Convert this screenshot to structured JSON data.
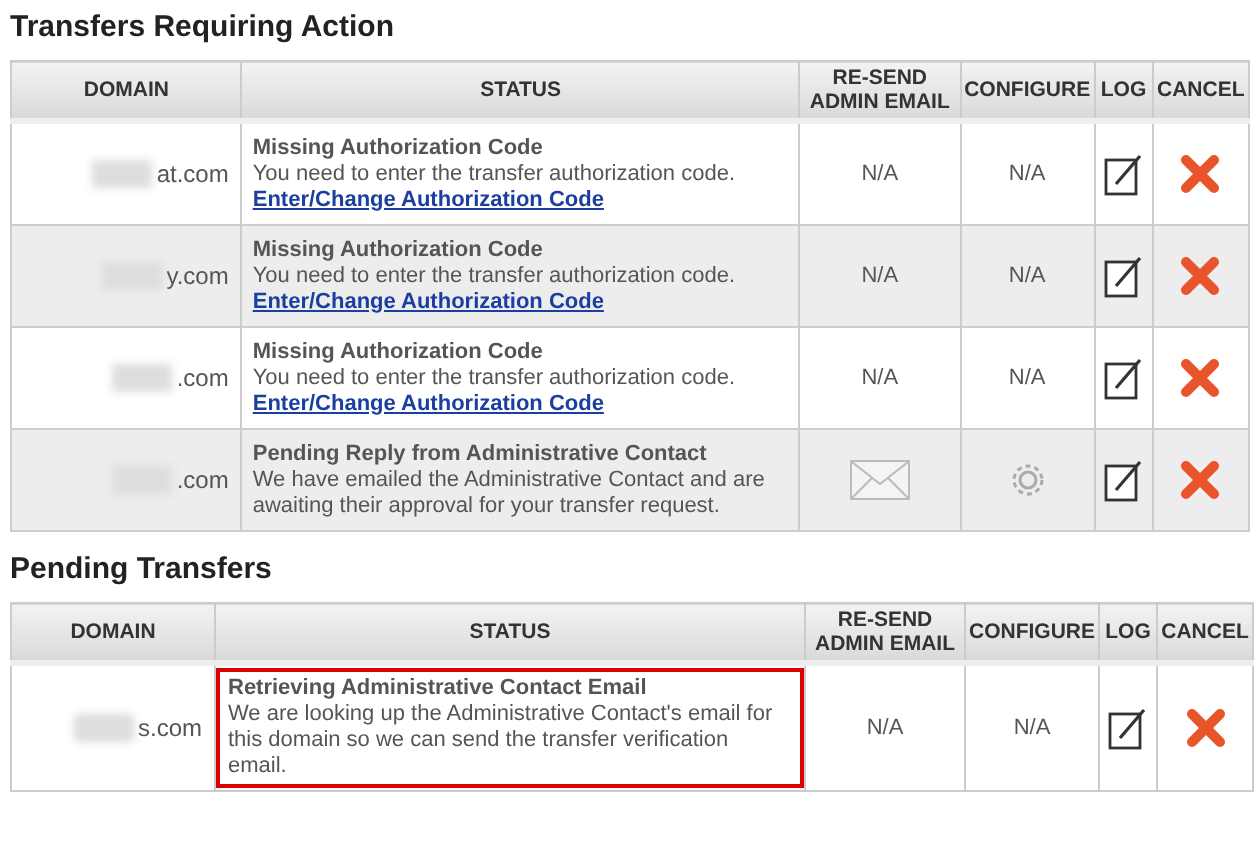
{
  "sections": [
    {
      "title": "Transfers Requiring Action",
      "columns": [
        "DOMAIN",
        "STATUS",
        "RE-SEND ADMIN EMAIL",
        "CONFIGURE",
        "LOG",
        "CANCEL"
      ],
      "rows": [
        {
          "domain": "at.com",
          "status_title": "Missing Authorization Code",
          "status_text": "You need to enter the transfer authorization code.",
          "link": "Enter/Change Authorization Code",
          "resend": {
            "kind": "text",
            "text": "N/A"
          },
          "configure": {
            "kind": "text",
            "text": "N/A"
          },
          "highlighted": false
        },
        {
          "domain": "y.com",
          "status_title": "Missing Authorization Code",
          "status_text": "You need to enter the transfer authorization code.",
          "link": "Enter/Change Authorization Code",
          "resend": {
            "kind": "text",
            "text": "N/A"
          },
          "configure": {
            "kind": "text",
            "text": "N/A"
          },
          "highlighted": false
        },
        {
          "domain": ".com",
          "status_title": "Missing Authorization Code",
          "status_text": "You need to enter the transfer authorization code.",
          "link": "Enter/Change Authorization Code",
          "resend": {
            "kind": "text",
            "text": "N/A"
          },
          "configure": {
            "kind": "text",
            "text": "N/A"
          },
          "highlighted": false
        },
        {
          "domain": ".com",
          "status_title": "Pending Reply from Administrative Contact",
          "status_text": "We have emailed the Administrative Contact and are awaiting their approval for your transfer request.",
          "resend": {
            "kind": "email"
          },
          "configure": {
            "kind": "gear"
          },
          "highlighted": false
        }
      ]
    },
    {
      "title": "Pending Transfers",
      "columns": [
        "DOMAIN",
        "STATUS",
        "RE-SEND ADMIN EMAIL",
        "CONFIGURE",
        "LOG",
        "CANCEL"
      ],
      "rows": [
        {
          "domain": "s.com",
          "status_title": "Retrieving Administrative Contact Email",
          "status_text": "We are looking up the Administrative Contact's email for this domain so we can send the transfer verification email.",
          "resend": {
            "kind": "text",
            "text": "N/A"
          },
          "configure": {
            "kind": "text",
            "text": "N/A"
          },
          "highlighted": true
        }
      ]
    }
  ]
}
